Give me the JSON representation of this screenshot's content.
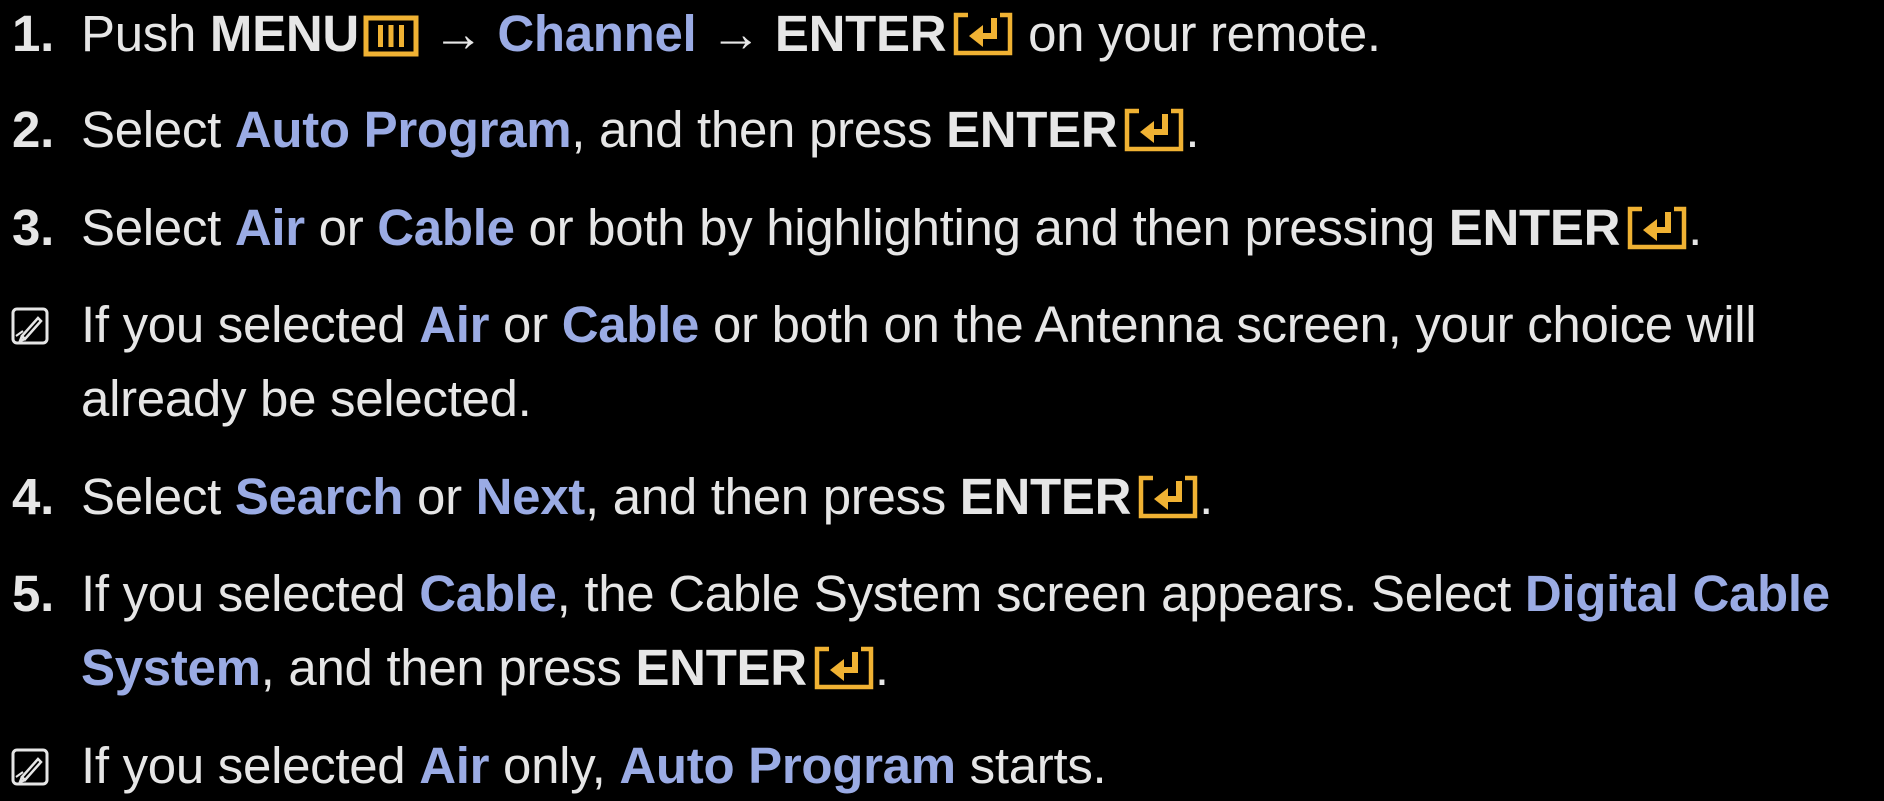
{
  "accent_color": "#9aabe4",
  "icon_color": "#f0b233",
  "text_color": "#e6e6e6",
  "icons": {
    "menu": "menu-button-icon",
    "enter": "enter-button-icon",
    "note": "note-pencil-icon"
  },
  "steps": {
    "s1": {
      "num": "1.",
      "a": "Push ",
      "b": "MENU",
      "c": " → ",
      "d": "Channel",
      "e": " → ",
      "f": "ENTER",
      "g": " on your remote."
    },
    "s2": {
      "num": "2.",
      "a": "Select ",
      "b": "Auto Program",
      "c": ", and then press ",
      "d": "ENTER",
      "e": "."
    },
    "s3": {
      "num": "3.",
      "a": "Select ",
      "b": "Air",
      "c": " or ",
      "d": "Cable",
      "e": " or both by highlighting and then pressing ",
      "f": "ENTER",
      "g": "."
    },
    "n1": {
      "a": "If you selected ",
      "b": "Air",
      "c": " or ",
      "d": "Cable",
      "e": " or both on the Antenna screen, your choice will",
      "f": "already be selected."
    },
    "s4": {
      "num": "4.",
      "a": "Select ",
      "b": "Search",
      "c": " or ",
      "d": "Next",
      "e": ", and then press ",
      "f": "ENTER",
      "g": "."
    },
    "s5": {
      "num": "5.",
      "a": "If you selected ",
      "b": "Cable",
      "c": ", the Cable System screen appears. Select ",
      "d": "Digital Cable",
      "e": "System",
      "f": ", and then press ",
      "g": "ENTER",
      "h": "."
    },
    "n2": {
      "a": "If you selected ",
      "b": "Air",
      "c": " only, ",
      "d": "Auto Program",
      "e": " starts."
    }
  }
}
